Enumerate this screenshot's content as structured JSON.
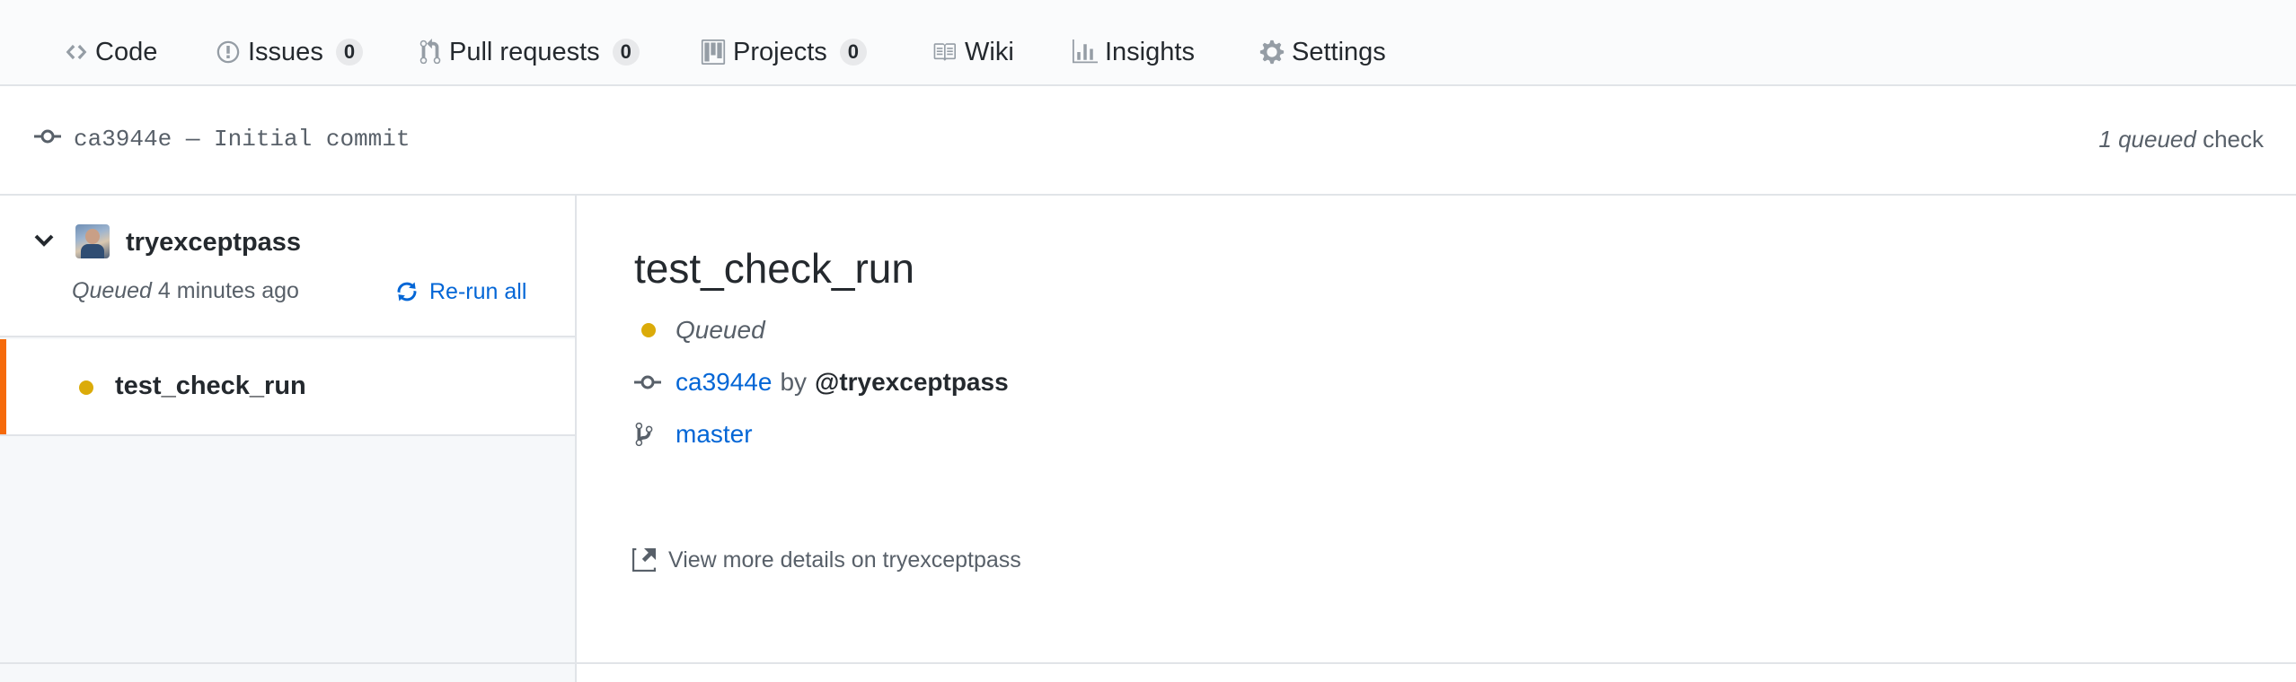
{
  "nav": {
    "tabs": [
      {
        "label": "Code",
        "icon": "code-icon"
      },
      {
        "label": "Issues",
        "icon": "issue-icon",
        "count": "0"
      },
      {
        "label": "Pull requests",
        "icon": "pull-request-icon",
        "count": "0"
      },
      {
        "label": "Projects",
        "icon": "project-icon",
        "count": "0"
      },
      {
        "label": "Wiki",
        "icon": "book-icon"
      },
      {
        "label": "Insights",
        "icon": "graph-icon"
      },
      {
        "label": "Settings",
        "icon": "gear-icon"
      }
    ]
  },
  "commit_bar": {
    "icon": "commit-icon",
    "text": "ca3944e — Initial commit",
    "queued_emphasis": "1 queued",
    "queued_suffix": " check"
  },
  "sidebar": {
    "suite": {
      "expand_icon": "chevron-down-icon",
      "app_name": "tryexceptpass",
      "status_label": "Queued",
      "status_time": " 4 minutes ago",
      "rerun_label": "Re-run all",
      "rerun_icon": "sync-icon"
    },
    "runs": [
      {
        "name": "test_check_run",
        "status_color": "#dbab09",
        "active": true
      }
    ]
  },
  "main": {
    "title": "test_check_run",
    "status": "Queued",
    "commit_sha": "ca3944e",
    "by_text": "by",
    "author": "@tryexceptpass",
    "branch": "master",
    "details_link": "View more details on tryexceptpass",
    "details_icon": "link-external-icon"
  },
  "colors": {
    "link": "#0366d6",
    "queued": "#dbab09",
    "active_marker": "#f66a0a"
  }
}
